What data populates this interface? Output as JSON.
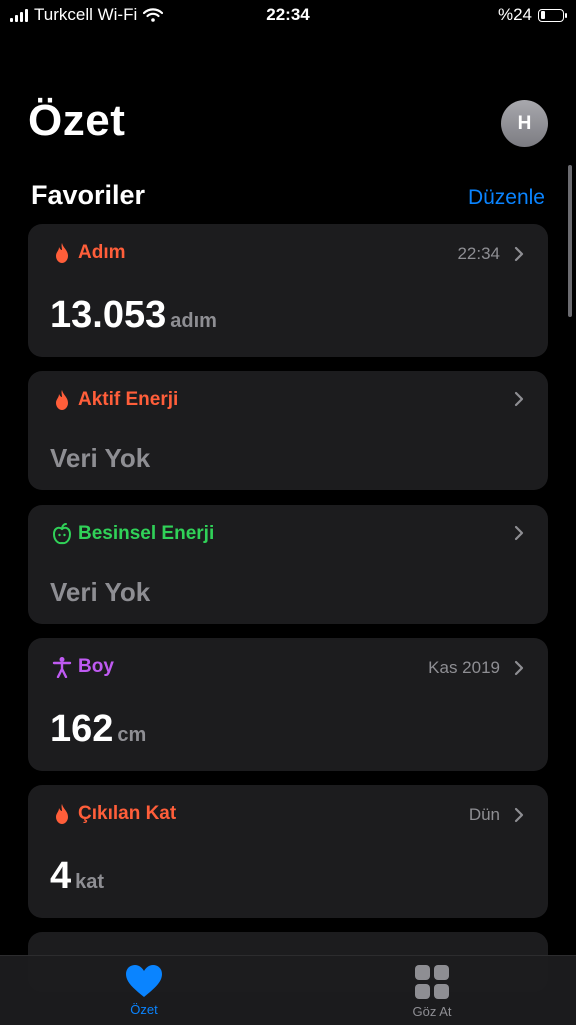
{
  "status": {
    "carrier": "Turkcell Wi-Fi",
    "time": "22:34",
    "battery": "%24",
    "battery_level": 0.24
  },
  "header": {
    "title": "Özet",
    "avatar_initial": "H"
  },
  "favorites": {
    "title": "Favoriler",
    "edit_label": "Düzenle"
  },
  "cards": [
    {
      "label": "Adım",
      "meta": "22:34",
      "value": "13.053",
      "unit": "adım",
      "color": "#ff5e3a",
      "icon": "flame-icon"
    },
    {
      "label": "Aktif Enerji",
      "meta": "",
      "value": "Veri Yok",
      "color": "#ff5e3a",
      "icon": "flame-icon"
    },
    {
      "label": "Besinsel Enerji",
      "meta": "",
      "value": "Veri Yok",
      "color": "#30d158",
      "icon": "apple-icon"
    },
    {
      "label": "Boy",
      "meta": "Kas 2019",
      "value": "162",
      "unit": "cm",
      "color": "#bf5af2",
      "icon": "person-icon"
    },
    {
      "label": "Çıkılan Kat",
      "meta": "Dün",
      "value": "4",
      "unit": "kat",
      "color": "#ff5e3a",
      "icon": "flame-icon"
    }
  ],
  "tabs": [
    {
      "label": "Özet",
      "active": true,
      "icon": "heart-icon",
      "color": "#0a84ff"
    },
    {
      "label": "Göz At",
      "active": false,
      "icon": "grid-icon",
      "color": "#8e8e93"
    }
  ]
}
